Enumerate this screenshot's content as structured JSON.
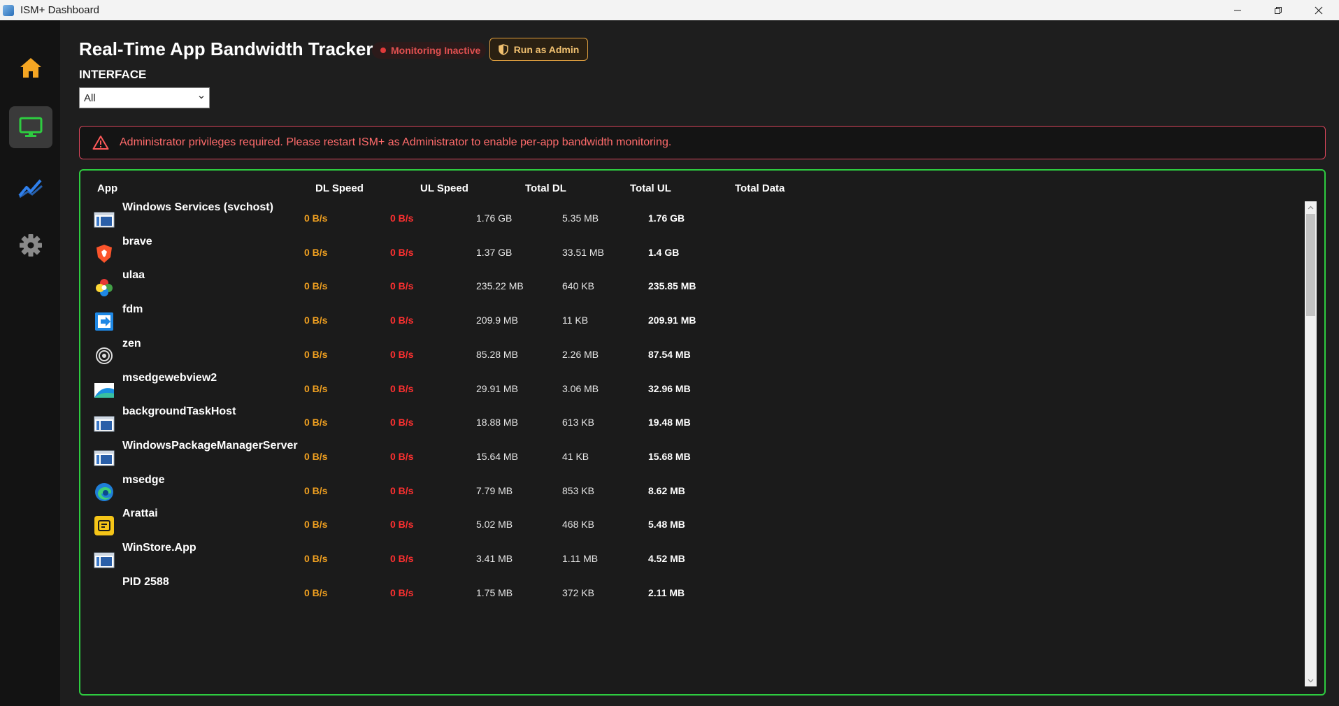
{
  "window": {
    "title": "ISM+ Dashboard"
  },
  "colors": {
    "accent_green": "#2ecc40",
    "dl_speed": "#f0a020",
    "ul_speed": "#ff3030",
    "alert": "#ff6b6b",
    "home_icon": "#f5a623",
    "monitor_icon": "#2ecc40",
    "chart_icon": "#2f80ed"
  },
  "sidebar": {
    "items": [
      {
        "icon": "home-icon",
        "active": false
      },
      {
        "icon": "monitor-icon",
        "active": true
      },
      {
        "icon": "chart-icon",
        "active": false
      },
      {
        "icon": "gear-icon",
        "active": false
      }
    ]
  },
  "header": {
    "title": "Real-Time App Bandwidth Tracker",
    "status": "Monitoring Inactive",
    "admin_button": "Run as Admin"
  },
  "interface": {
    "label": "INTERFACE",
    "selected": "All"
  },
  "alert": {
    "icon": "warning-icon",
    "message": "Administrator privileges required. Please restart ISM+ as Administrator to enable per-app bandwidth monitoring."
  },
  "table": {
    "columns": [
      "App",
      "DL Speed",
      "UL Speed",
      "Total DL",
      "Total UL",
      "Total Data"
    ],
    "rows": [
      {
        "icon": "windows-service-icon",
        "name": "Windows Services (svchost)",
        "dl": "0 B/s",
        "ul": "0 B/s",
        "total_dl": "1.76 GB",
        "total_ul": "5.35 MB",
        "total": "1.76 GB"
      },
      {
        "icon": "brave-icon",
        "name": "brave",
        "dl": "0 B/s",
        "ul": "0 B/s",
        "total_dl": "1.37 GB",
        "total_ul": "33.51 MB",
        "total": "1.4 GB"
      },
      {
        "icon": "ulaa-icon",
        "name": "ulaa",
        "dl": "0 B/s",
        "ul": "0 B/s",
        "total_dl": "235.22 MB",
        "total_ul": "640 KB",
        "total": "235.85 MB"
      },
      {
        "icon": "fdm-icon",
        "name": "fdm",
        "dl": "0 B/s",
        "ul": "0 B/s",
        "total_dl": "209.9 MB",
        "total_ul": "11 KB",
        "total": "209.91 MB"
      },
      {
        "icon": "zen-icon",
        "name": "zen",
        "dl": "0 B/s",
        "ul": "0 B/s",
        "total_dl": "85.28 MB",
        "total_ul": "2.26 MB",
        "total": "87.54 MB"
      },
      {
        "icon": "msedgewebview-icon",
        "name": "msedgewebview2",
        "dl": "0 B/s",
        "ul": "0 B/s",
        "total_dl": "29.91 MB",
        "total_ul": "3.06 MB",
        "total": "32.96 MB"
      },
      {
        "icon": "windows-service-icon",
        "name": "backgroundTaskHost",
        "dl": "0 B/s",
        "ul": "0 B/s",
        "total_dl": "18.88 MB",
        "total_ul": "613 KB",
        "total": "19.48 MB"
      },
      {
        "icon": "windows-service-icon",
        "name": "WindowsPackageManagerServer",
        "dl": "0 B/s",
        "ul": "0 B/s",
        "total_dl": "15.64 MB",
        "total_ul": "41 KB",
        "total": "15.68 MB"
      },
      {
        "icon": "edge-icon",
        "name": "msedge",
        "dl": "0 B/s",
        "ul": "0 B/s",
        "total_dl": "7.79 MB",
        "total_ul": "853 KB",
        "total": "8.62 MB"
      },
      {
        "icon": "arattai-icon",
        "name": "Arattai",
        "dl": "0 B/s",
        "ul": "0 B/s",
        "total_dl": "5.02 MB",
        "total_ul": "468 KB",
        "total": "5.48 MB"
      },
      {
        "icon": "windows-service-icon",
        "name": "WinStore.App",
        "dl": "0 B/s",
        "ul": "0 B/s",
        "total_dl": "3.41 MB",
        "total_ul": "1.11 MB",
        "total": "4.52 MB"
      },
      {
        "icon": "",
        "name": "PID 2588",
        "dl": "0 B/s",
        "ul": "0 B/s",
        "total_dl": "1.75 MB",
        "total_ul": "372 KB",
        "total": "2.11 MB"
      }
    ]
  }
}
